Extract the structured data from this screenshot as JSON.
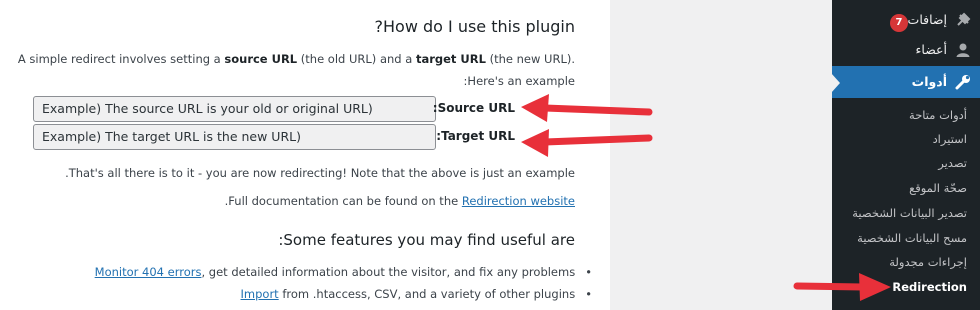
{
  "content": {
    "title": "How do I use this plugin?",
    "intro": {
      "p1": "A simple redirect involves setting a ",
      "source_url": "source URL",
      "p2": " (the old URL) and a ",
      "target_url": "target URL",
      "p3": " (the new URL). Here's an example:"
    },
    "fields": [
      {
        "label": "Source URL:",
        "value": "Example) The source URL is your old or original URL)"
      },
      {
        "label": "Target URL:",
        "value": "Example) The target URL is the new URL)"
      }
    ],
    "note": "That's all there is to it - you are now redirecting! Note that the above is just an example.",
    "docs_prefix": "Full documentation can be found on the ",
    "docs_link": "Redirection website",
    "docs_suffix": ".",
    "features_title": "Some features you may find useful are:",
    "features": [
      {
        "link": "Monitor 404 errors",
        "text": ", get detailed information about the visitor, and fix any problems"
      },
      {
        "link": "Import",
        "text": " from .htaccess, CSV, and a variety of other plugins"
      }
    ]
  },
  "menu": {
    "plugins_label": "إضافات",
    "plugins_badge": "7",
    "users_label": "أعضاء",
    "tools_label": "أدوات",
    "submenu": [
      "أدوات متاحة",
      "استيراد",
      "تصدير",
      "صحّة الموقع",
      "تصدير البيانات الشخصية",
      "مسح البيانات الشخصية",
      "إجراءات مجدولة",
      "Redirection"
    ]
  },
  "colors": {
    "annotation_arrow": "#e8303a",
    "menu_bg": "#1d2327",
    "menu_current": "#2271b1",
    "link": "#2271b1"
  }
}
